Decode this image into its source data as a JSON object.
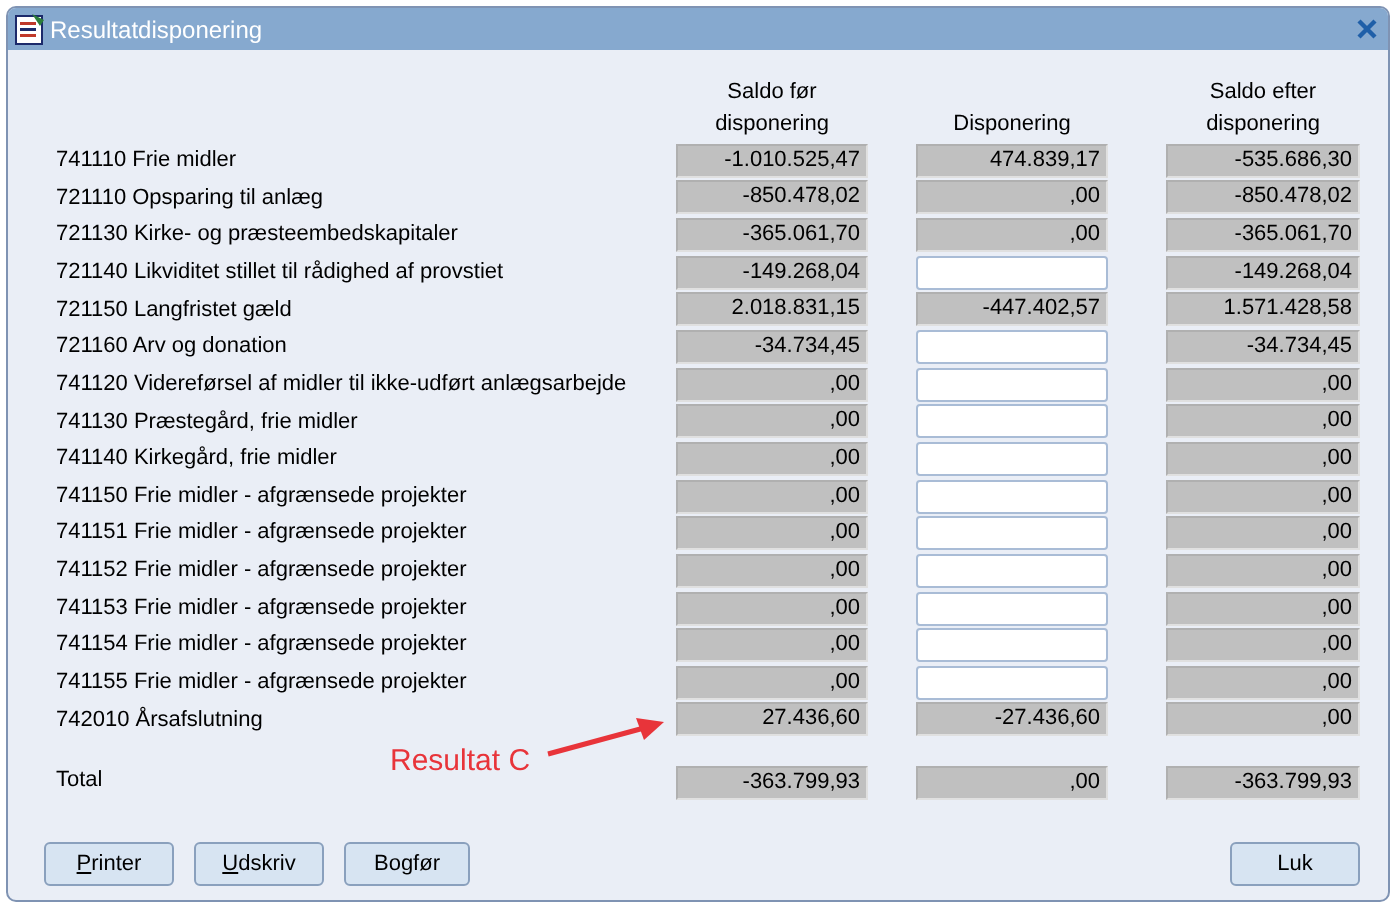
{
  "window": {
    "title": "Resultatdisponering",
    "active": false
  },
  "columns": [
    "Saldo før disponering",
    "Disponering",
    "Saldo efter disponering"
  ],
  "rows": [
    {
      "label": "741110 Frie midler",
      "before": "-1.010.525,47",
      "disposition": {
        "editable": false,
        "value": "474.839,17"
      },
      "after": "-535.686,30"
    },
    {
      "label": "721110 Opsparing til anlæg",
      "before": "-850.478,02",
      "disposition": {
        "editable": false,
        "value": ",00"
      },
      "after": "-850.478,02"
    },
    {
      "label": "721130 Kirke- og præsteembedskapitaler",
      "before": "-365.061,70",
      "disposition": {
        "editable": false,
        "value": ",00"
      },
      "after": "-365.061,70"
    },
    {
      "label": "721140 Likviditet stillet til rådighed af provstiet",
      "before": "-149.268,04",
      "disposition": {
        "editable": true
      },
      "after": "-149.268,04"
    },
    {
      "label": "721150 Langfristet gæld",
      "before": "2.018.831,15",
      "disposition": {
        "editable": false,
        "value": "-447.402,57"
      },
      "after": "1.571.428,58"
    },
    {
      "label": "721160 Arv og donation",
      "before": "-34.734,45",
      "disposition": {
        "editable": true
      },
      "after": "-34.734,45"
    },
    {
      "label": "741120 Videreførsel af midler til ikke-udført anlægsarbejde",
      "before": ",00",
      "disposition": {
        "editable": true
      },
      "after": ",00"
    },
    {
      "label": "741130 Præstegård, frie midler",
      "before": ",00",
      "disposition": {
        "editable": true
      },
      "after": ",00"
    },
    {
      "label": "741140 Kirkegård, frie midler",
      "before": ",00",
      "disposition": {
        "editable": true
      },
      "after": ",00"
    },
    {
      "label": "741150 Frie midler - afgrænsede projekter",
      "before": ",00",
      "disposition": {
        "editable": true
      },
      "after": ",00"
    },
    {
      "label": "741151 Frie midler - afgrænsede projekter",
      "before": ",00",
      "disposition": {
        "editable": true
      },
      "after": ",00"
    },
    {
      "label": "741152 Frie midler - afgrænsede projekter",
      "before": ",00",
      "disposition": {
        "editable": true
      },
      "after": ",00"
    },
    {
      "label": "741153 Frie midler - afgrænsede projekter",
      "before": ",00",
      "disposition": {
        "editable": true
      },
      "after": ",00"
    },
    {
      "label": "741154 Frie midler - afgrænsede projekter",
      "before": ",00",
      "disposition": {
        "editable": true
      },
      "after": ",00"
    },
    {
      "label": "741155 Frie midler - afgrænsede projekter",
      "before": ",00",
      "disposition": {
        "editable": true
      },
      "after": ",00"
    },
    {
      "label": "742010 Årsafslutning",
      "before": "27.436,60",
      "disposition": {
        "editable": false,
        "value": "-27.436,60"
      },
      "after": ",00"
    }
  ],
  "total": {
    "label": "Total",
    "before": "-363.799,93",
    "disposition": ",00",
    "after": "-363.799,93"
  },
  "annotation": {
    "text": "Resultat C"
  },
  "buttons_left": [
    {
      "label": "Printer",
      "mnemonic_first": true
    },
    {
      "label": "Udskriv",
      "mnemonic_first": true
    },
    {
      "label": "Bogfør",
      "mnemonic_first": false
    }
  ],
  "buttons_right": [
    {
      "label": "Luk",
      "mnemonic_first": false
    }
  ]
}
